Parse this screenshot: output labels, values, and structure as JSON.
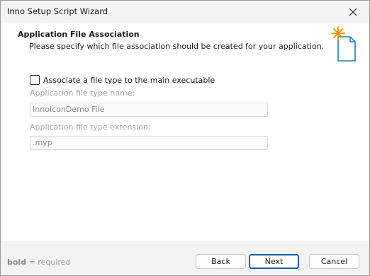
{
  "window": {
    "title": "Inno Setup Script Wizard"
  },
  "header": {
    "title": "Application File Association",
    "description": "Please specify which file association should be created for your application."
  },
  "form": {
    "associate_label": "Associate a file type to the main executable",
    "associate_checked": false,
    "type_name_label": "Application file type name:",
    "type_name_value": "InnoIconDemo File",
    "type_ext_label": "Application file type extension:",
    "type_ext_value": ".myp"
  },
  "footer": {
    "legend_bold": "bold",
    "legend_rest": " = required",
    "back_label": "Back",
    "next_label": "Next",
    "cancel_label": "Cancel"
  },
  "colors": {
    "accent": "#005fb8",
    "icon_orange": "#f08c00",
    "icon_blue": "#1a7fc1"
  },
  "icons": {
    "close": "close-icon",
    "wizard": "new-file-sparkle-icon"
  }
}
